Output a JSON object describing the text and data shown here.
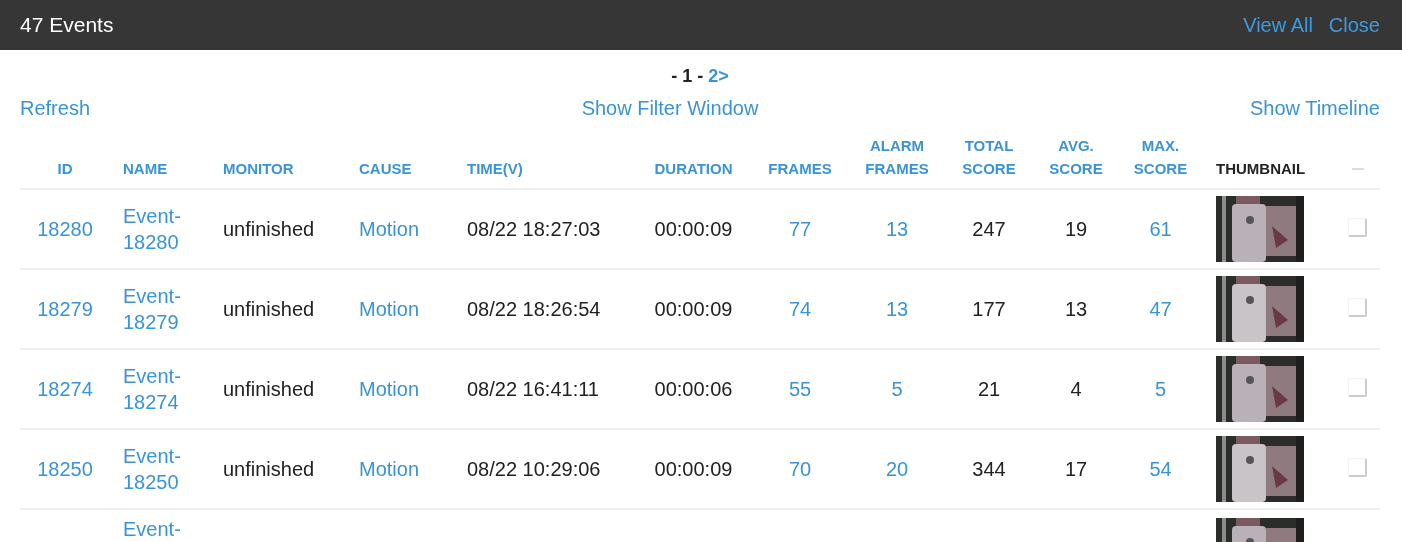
{
  "header": {
    "title": "47 Events",
    "links": [
      "View All",
      "Close"
    ]
  },
  "pagination": {
    "separator": "-",
    "pages": [
      {
        "label": "1",
        "selected": true
      },
      {
        "label": "2>",
        "selected": false
      }
    ]
  },
  "toolbar": {
    "left": "Refresh",
    "center": "Show Filter Window",
    "right": "Show Timeline"
  },
  "table": {
    "columns": [
      {
        "label": "ID",
        "sortable": true
      },
      {
        "label": "NAME",
        "sortable": true
      },
      {
        "label": "MONITOR",
        "sortable": true
      },
      {
        "label": "CAUSE",
        "sortable": true
      },
      {
        "label": "TIME(V)",
        "sortable": true
      },
      {
        "label": "DURATION",
        "sortable": true
      },
      {
        "label": "FRAMES",
        "sortable": true
      },
      {
        "label": "ALARM FRAMES",
        "sortable": true
      },
      {
        "label": "TOTAL SCORE",
        "sortable": true
      },
      {
        "label": "AVG. SCORE",
        "sortable": true
      },
      {
        "label": "MAX. SCORE",
        "sortable": true
      },
      {
        "label": "THUMBNAIL",
        "sortable": false
      }
    ],
    "select_all": {
      "disabled": true
    },
    "rows": [
      {
        "id": "18280",
        "name": "Event-18280",
        "monitor": "unfinished",
        "cause": "Motion",
        "time": "08/22 18:27:03",
        "duration": "00:00:09",
        "frames": "77",
        "alarm_frames": "13",
        "total_score": "247",
        "avg_score": "19",
        "max_score": "61",
        "checked": false
      },
      {
        "id": "18279",
        "name": "Event-18279",
        "monitor": "unfinished",
        "cause": "Motion",
        "time": "08/22 18:26:54",
        "duration": "00:00:09",
        "frames": "74",
        "alarm_frames": "13",
        "total_score": "177",
        "avg_score": "13",
        "max_score": "47",
        "checked": false
      },
      {
        "id": "18274",
        "name": "Event-18274",
        "monitor": "unfinished",
        "cause": "Motion",
        "time": "08/22 16:41:11",
        "duration": "00:00:06",
        "frames": "55",
        "alarm_frames": "5",
        "total_score": "21",
        "avg_score": "4",
        "max_score": "5",
        "checked": false
      },
      {
        "id": "18250",
        "name": "Event-18250",
        "monitor": "unfinished",
        "cause": "Motion",
        "time": "08/22 10:29:06",
        "duration": "00:00:09",
        "frames": "70",
        "alarm_frames": "20",
        "total_score": "344",
        "avg_score": "17",
        "max_score": "54",
        "checked": false
      },
      {
        "name": "Event-"
      }
    ]
  }
}
